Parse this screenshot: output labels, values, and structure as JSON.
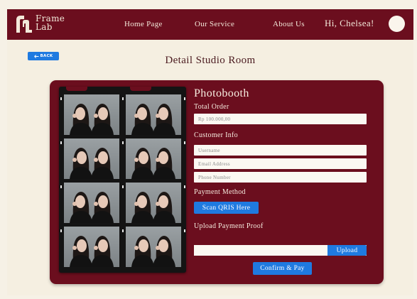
{
  "brand": {
    "line1": "Frame",
    "line2": "Lab"
  },
  "nav": {
    "links": [
      "Home Page",
      "Our Service",
      "About Us"
    ],
    "greeting": "Hi, Chelsea!"
  },
  "back_label": "BACK",
  "page_title": "Detail Studio Room",
  "form": {
    "title": "Photobooth",
    "total_order_label": "Total Order",
    "total_order_value": "Rp 100.000,00",
    "customer_info_label": "Customer Info",
    "username_placeholder": "Username",
    "email_placeholder": "Email Address",
    "phone_placeholder": "Phone Number",
    "payment_method_label": "Payment Method",
    "scan_qris_label": "Scan QRIS Here",
    "upload_proof_label": "Upload Payment Proof",
    "upload_button_label": "Upload",
    "confirm_label": "Confirm & Pay"
  },
  "icons": {
    "back": "arrow-left-icon",
    "logo": "frame-lab-logo-icon"
  },
  "colors": {
    "navbar": "#6b0e1e",
    "card": "#6b0e1e",
    "accent_blue": "#1f7ae0",
    "page_bg": "#f5efe1"
  }
}
